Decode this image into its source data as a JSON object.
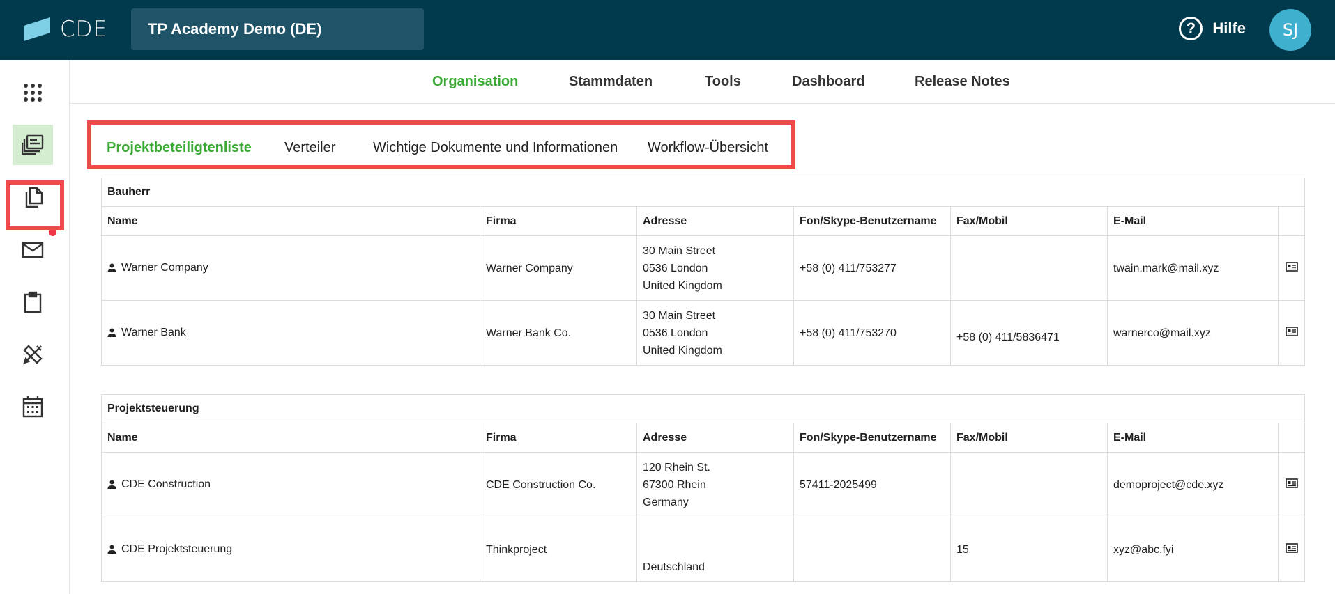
{
  "app": {
    "logo_text": "CDE",
    "project_name": "TP Academy Demo (DE)",
    "help_label": "Hilfe",
    "avatar_initials": "SJ",
    "accent_color": "#3aaa35",
    "header_color": "#003a4c",
    "highlight_color": "#f04b4b"
  },
  "sidebar": {
    "items": [
      {
        "icon": "apps-grid-icon"
      },
      {
        "icon": "project-list-icon",
        "active": true
      },
      {
        "icon": "documents-icon"
      },
      {
        "icon": "mail-icon",
        "notification": true
      },
      {
        "icon": "clipboard-icon"
      },
      {
        "icon": "tools-icon"
      },
      {
        "icon": "calendar-icon"
      }
    ]
  },
  "nav": {
    "items": [
      "Organisation",
      "Stammdaten",
      "Tools",
      "Dashboard",
      "Release Notes"
    ],
    "active": "Organisation"
  },
  "subtabs": {
    "items": [
      "Projektbeteiligtenliste",
      "Verteiler",
      "Wichtige Dokumente und Informationen",
      "Workflow-Übersicht"
    ],
    "active": "Projektbeteiligtenliste"
  },
  "columns": [
    "Name",
    "Firma",
    "Adresse",
    "Fon/Skype-Benutzername",
    "Fax/Mobil",
    "E-Mail"
  ],
  "groups": [
    {
      "title": "Bauherr",
      "rows": [
        {
          "name": "Warner Company",
          "firma": "Warner Company",
          "address": [
            "30 Main Street",
            "0536 London",
            "United Kingdom"
          ],
          "fon": "+58 (0) 411/753277",
          "fax": "",
          "email": "twain.mark@mail.xyz"
        },
        {
          "name": "Warner Bank",
          "firma": "Warner Bank Co.",
          "address": [
            "30 Main Street",
            "0536 London",
            "United Kingdom"
          ],
          "fon": "+58 (0) 411/753270",
          "fax": "+58 (0) 411/5836471",
          "email": "warnerco@mail.xyz"
        }
      ]
    },
    {
      "title": "Projektsteuerung",
      "rows": [
        {
          "name": "CDE Construction",
          "firma": "CDE Construction Co.",
          "address": [
            "120 Rhein St.",
            "67300 Rhein",
            "Germany"
          ],
          "fon": "57411-2025499",
          "fax": "",
          "email": "demoproject@cde.xyz"
        },
        {
          "name": "CDE Projektsteuerung",
          "firma": "Thinkproject",
          "address": [
            "",
            "",
            "Deutschland"
          ],
          "fon": "",
          "fax": "15",
          "email": "xyz@abc.fyi"
        }
      ]
    }
  ]
}
